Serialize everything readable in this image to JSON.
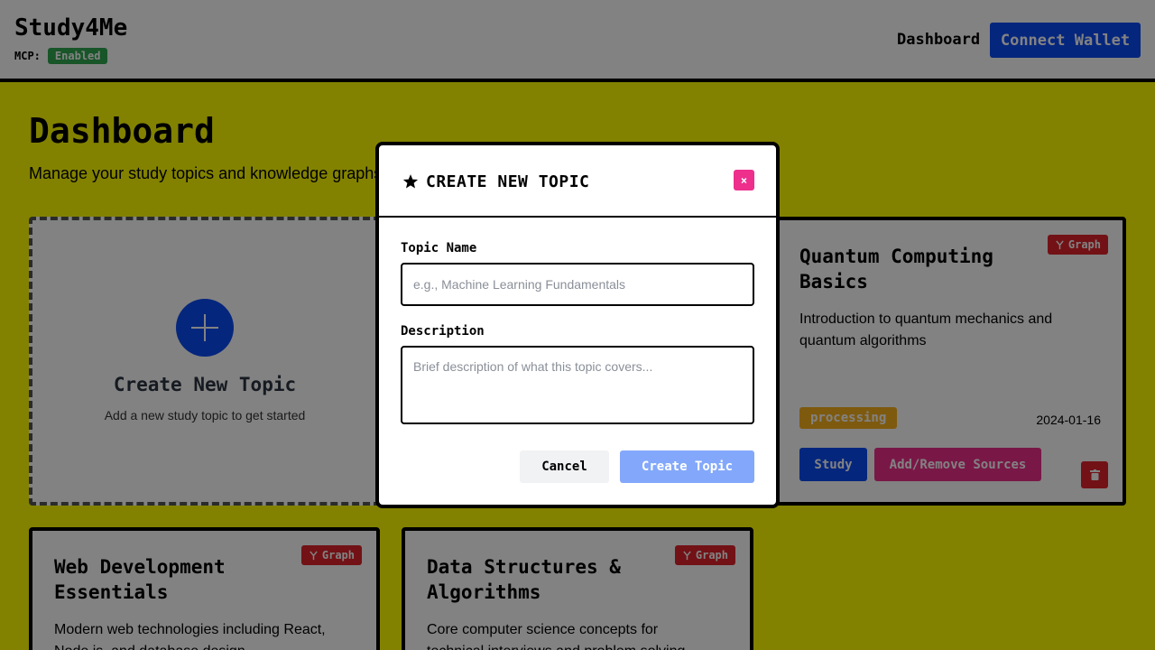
{
  "header": {
    "brand": "Study4Me",
    "mcp_label": "MCP:",
    "mcp_status": "Enabled",
    "nav_dashboard": "Dashboard",
    "connect_wallet": "Connect Wallet"
  },
  "main": {
    "title": "Dashboard",
    "subtitle": "Manage your study topics and knowledge graphs",
    "create_card": {
      "title": "Create New Topic",
      "subtitle": "Add a new study topic to get started"
    },
    "topics": [
      {
        "title": "Quantum Computing Basics",
        "description": "Introduction to quantum mechanics and quantum algorithms",
        "graph_label": "Graph",
        "status": "processing",
        "date": "2024-01-16",
        "study_label": "Study",
        "sources_label": "Add/Remove Sources"
      },
      {
        "title": "Web Development Essentials",
        "description": "Modern web technologies including React, Node.js, and database design",
        "graph_label": "Graph"
      },
      {
        "title": "Data Structures & Algorithms",
        "description": "Core computer science concepts for technical interviews and problem solving",
        "graph_label": "Graph"
      }
    ]
  },
  "modal": {
    "title": "CREATE NEW TOPIC",
    "close_label": "×",
    "name_label": "Topic Name",
    "name_placeholder": "e.g., Machine Learning Fundamentals",
    "description_label": "Description",
    "description_placeholder": "Brief description of what this topic covers...",
    "cancel_label": "Cancel",
    "submit_label": "Create Topic"
  },
  "colors": {
    "accent_blue": "#0b4cf5",
    "accent_pink": "#ee2f8c",
    "graph_red": "#e0252b",
    "status_processing": "#f7b11e",
    "mcp_green": "#2fa84f",
    "background_yellow": "#ffff00"
  },
  "icons": {
    "modal_title": "star-icon",
    "graph_badge": "graph-branch-icon",
    "delete": "trash-icon",
    "create": "plus-icon"
  }
}
